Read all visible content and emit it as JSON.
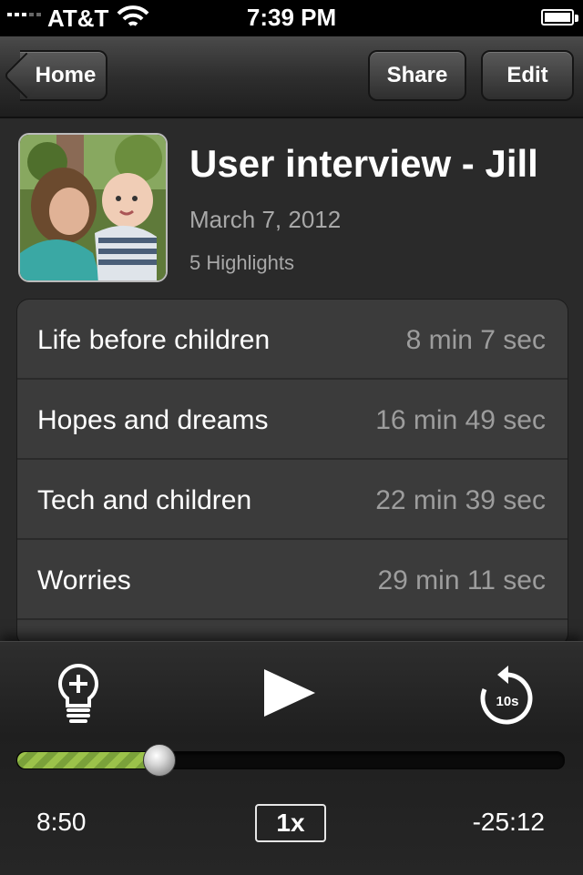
{
  "status_bar": {
    "carrier": "AT&T",
    "time": "7:39 PM"
  },
  "nav": {
    "back_label": "Home",
    "share_label": "Share",
    "edit_label": "Edit"
  },
  "recording": {
    "title": "User interview - Jill",
    "date": "March 7, 2012",
    "highlights_count": "5 Highlights"
  },
  "highlights": [
    {
      "label": "Life before children",
      "duration": "8 min 7 sec"
    },
    {
      "label": "Hopes and dreams",
      "duration": "16 min 49 sec"
    },
    {
      "label": "Tech and children",
      "duration": "22 min 39 sec"
    },
    {
      "label": "Worries",
      "duration": "29 min 11 sec"
    },
    {
      "label": "",
      "duration": ""
    }
  ],
  "player": {
    "elapsed": "8:50",
    "remaining": "-25:12",
    "speed": "1x",
    "skip_label": "10s",
    "progress": 0.26
  },
  "colors": {
    "progress_green": "#8db544",
    "background": "#2a2a2a"
  },
  "icons": [
    "back-arrow-icon",
    "wifi-icon",
    "battery-icon",
    "add-highlight-bulb-icon",
    "play-icon",
    "skip-back-10s-icon"
  ]
}
